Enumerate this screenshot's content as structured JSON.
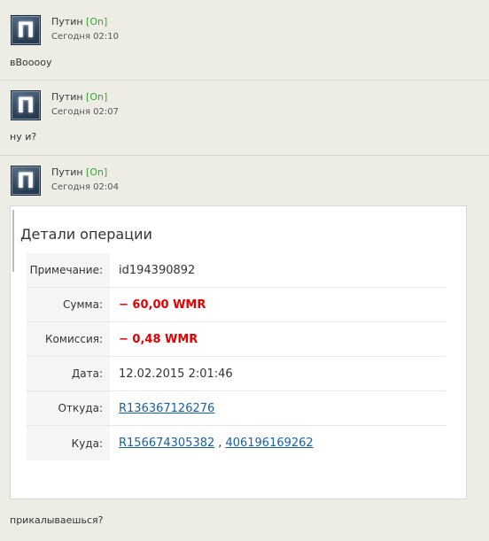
{
  "messages": [
    {
      "author": "Путин",
      "status": "[On]",
      "time": "Сегодня 02:10",
      "text": "вВооооу"
    },
    {
      "author": "Путин",
      "status": "[On]",
      "time": "Сегодня 02:07",
      "text": "ну и?"
    },
    {
      "author": "Путин",
      "status": "[On]",
      "time": "Сегодня 02:04",
      "text": "прикалываешься?"
    }
  ],
  "avatar_glyph": "П",
  "operation": {
    "title": "Детали операции",
    "rows": [
      {
        "label": "Примечание:",
        "value": "id194390892"
      },
      {
        "label": "Сумма:",
        "value": "− 60,00 WMR"
      },
      {
        "label": "Комиссия:",
        "value": "− 0,48 WMR"
      },
      {
        "label": "Дата:",
        "value": "12.02.2015 2:01:46"
      },
      {
        "label": "Откуда:",
        "value": "R136367126276"
      },
      {
        "label": "Куда:",
        "value": "R156674305382",
        "value2": "406196169262"
      }
    ]
  },
  "colors": {
    "background": "#eeede5",
    "status_online": "#35a535",
    "negative": "#e30000",
    "link": "#1a5fa0"
  }
}
